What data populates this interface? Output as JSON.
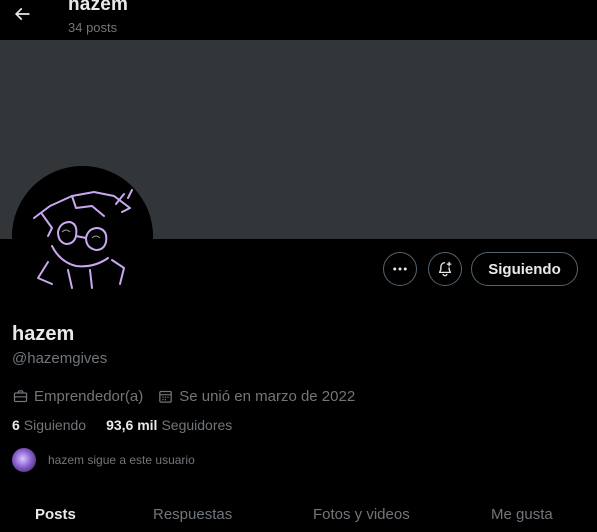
{
  "header": {
    "title": "hazem",
    "post_count": "34 posts"
  },
  "colors": {
    "background": "#000000",
    "banner": "#333639",
    "text_primary": "#e7e9ea",
    "text_secondary": "#71767b",
    "button_border": "#536471"
  },
  "profile": {
    "display_name": "hazem",
    "handle": "@hazemgives",
    "occupation": "Emprendedor(a)",
    "joined": "Se unió en marzo de 2022",
    "following_count": "6",
    "following_label": "Siguiendo",
    "followers_count": "93,6 mil",
    "followers_label": "Seguidores",
    "followed_by_text": "hazem sigue a este usuario"
  },
  "actions": {
    "follow_label": "Siguiendo",
    "more_icon": "more-icon",
    "notify_icon": "bell-plus-icon"
  },
  "tabs": [
    {
      "label": "Posts",
      "active": true
    },
    {
      "label": "Respuestas",
      "active": false
    },
    {
      "label": "Fotos y videos",
      "active": false
    },
    {
      "label": "Me gusta",
      "active": false
    }
  ]
}
